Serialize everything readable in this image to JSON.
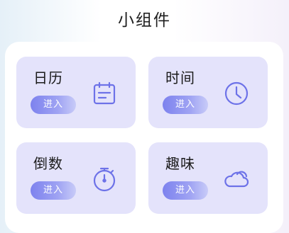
{
  "page": {
    "title": "小组件"
  },
  "widgets": [
    {
      "title": "日历",
      "button_label": "进入",
      "icon": "calendar-icon"
    },
    {
      "title": "时间",
      "button_label": "进入",
      "icon": "clock-icon"
    },
    {
      "title": "倒数",
      "button_label": "进入",
      "icon": "stopwatch-icon"
    },
    {
      "title": "趣味",
      "button_label": "进入",
      "icon": "cloud-icon"
    }
  ],
  "colors": {
    "card_background": "#e4e3fb",
    "accent": "#7d82ee",
    "icon_stroke": "#6d72e8"
  }
}
